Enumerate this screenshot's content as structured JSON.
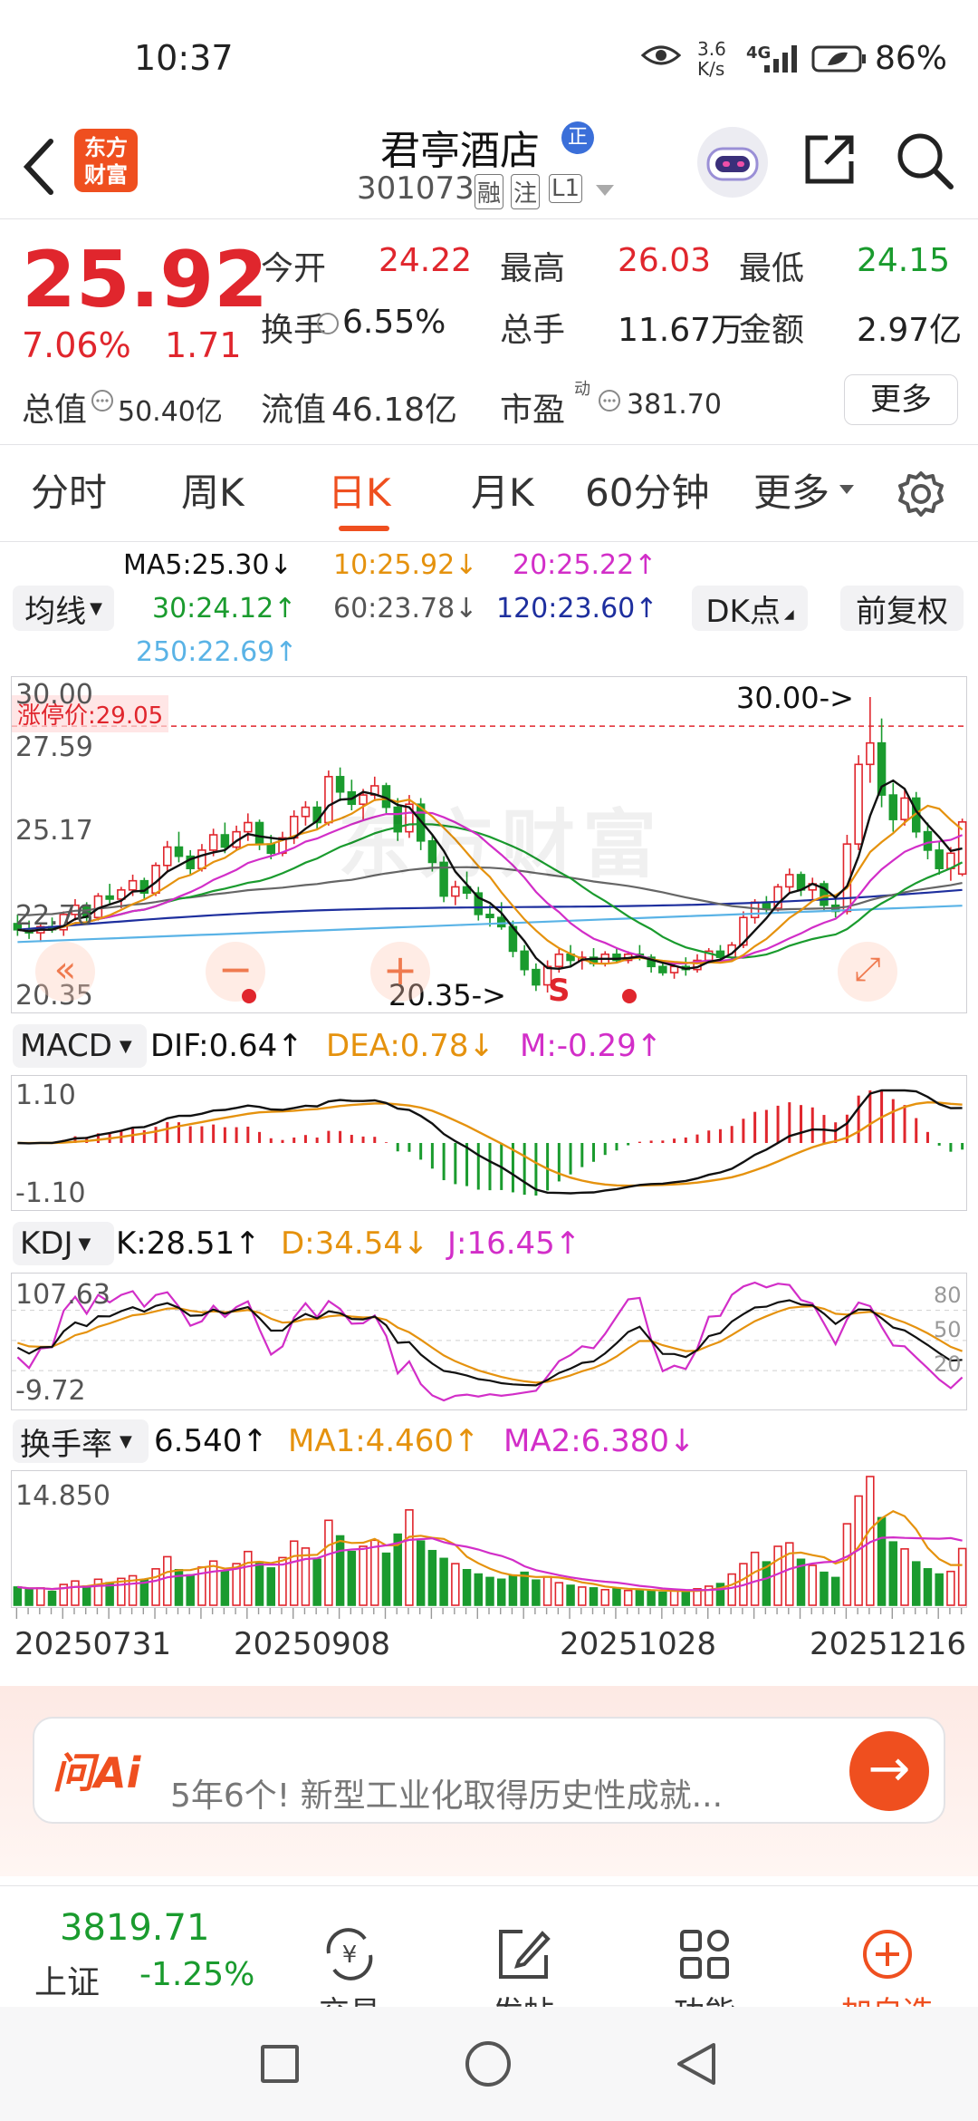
{
  "status": {
    "time": "10:37",
    "net_speed_value": "3.6",
    "net_speed_unit": "K/s",
    "network": "4G",
    "battery": "86%"
  },
  "header": {
    "title": "君亭酒店",
    "title_badge": "正",
    "code": "301073",
    "tags": [
      "融",
      "注",
      "L1"
    ],
    "logo_line1": "东方",
    "logo_line2": "财富",
    "back_icon": "back-arrow-icon",
    "share_icon": "share-icon",
    "search_icon": "search-icon"
  },
  "quote": {
    "price": "25.92",
    "change_pct": "7.06%",
    "change": "1.71",
    "fields": [
      {
        "label": "今开",
        "value": "24.22",
        "color": "#e0262d"
      },
      {
        "label": "最高",
        "value": "26.03",
        "color": "#e0262d"
      },
      {
        "label": "最低",
        "value": "24.15",
        "color": "#1a9b2e"
      },
      {
        "label": "换手",
        "value": "6.55%",
        "color": "#222222"
      },
      {
        "label": "总手",
        "value": "11.67万",
        "color": "#222222"
      },
      {
        "label": "金额",
        "value": "2.97亿",
        "color": "#222222"
      }
    ],
    "mcap_label": "总值",
    "mcap_value": "50.40亿",
    "float_label": "流值",
    "float_value": "46.18亿",
    "pe_label": "市盈",
    "pe_sup": "动",
    "pe_value": "381.70",
    "more_button": "更多"
  },
  "tabs": {
    "items": [
      "分时",
      "周K",
      "日K",
      "月K",
      "60分钟",
      "更多"
    ],
    "active": "日K",
    "settings_icon": "gear-icon"
  },
  "ma": {
    "selector": "均线",
    "ma5": "MA5:25.30↓",
    "ma10": "10:25.92↓",
    "ma20": "20:25.22↑",
    "ma30": "30:24.12↑",
    "ma60": "60:23.78↓",
    "ma120": "120:23.60↑",
    "ma250": "250:22.69↑",
    "dk_button": "DK点",
    "fuquan_button": "前复权",
    "colors": {
      "ma5": "#111111",
      "ma10": "#e5920e",
      "ma20": "#d22ec8",
      "ma30": "#1a9b2e",
      "ma60": "#666666",
      "ma120": "#1e2f9e",
      "ma250": "#5ab3e6"
    }
  },
  "kline": {
    "limit_up_label": "涨停价:29.05",
    "high_marker": "30.00->",
    "low_marker": "20.35->",
    "s_marker": "S",
    "watermark": "东方财富",
    "y_ticks": [
      "30.00",
      "27.59",
      "25.17",
      "22.76",
      "20.35"
    ],
    "prev_icon": "double-chevron-left-icon",
    "zoom_out_icon": "minus-icon",
    "zoom_in_icon": "plus-icon",
    "expand_icon": "expand-icon"
  },
  "macd": {
    "selector": "MACD",
    "dif": "DIF:0.64↑",
    "dea": "DEA:0.78↓",
    "m": "M:-0.29↑",
    "y_ticks": [
      "1.10",
      "-1.10"
    ]
  },
  "kdj": {
    "selector": "KDJ",
    "k": "K:28.51↑",
    "d": "D:34.54↓",
    "j": "J:16.45↑",
    "y_ticks": [
      "107.63",
      "-9.72"
    ],
    "levels": [
      "80",
      "50",
      "20"
    ]
  },
  "turnover": {
    "selector": "换手率",
    "value": "6.540↑",
    "ma1": "MA1:4.460↑",
    "ma2": "MA2:6.380↓",
    "y_tick": "14.850"
  },
  "dates": [
    "20250731",
    "20250908",
    "20251028",
    "20251216"
  ],
  "ai_banner": {
    "brand": "问Ai",
    "text": "5年6个!  新型工业化取得历史性成就...",
    "go_icon": "arrow-right-icon"
  },
  "bottom_nav": {
    "index_value": "3819.71",
    "index_name": "上证",
    "index_change": "-1.25%",
    "items": [
      {
        "label": "交易",
        "icon": "yuan-exchange-icon"
      },
      {
        "label": "发帖",
        "icon": "edit-icon"
      },
      {
        "label": "功能",
        "icon": "grid-icon"
      },
      {
        "label": "加自选",
        "icon": "plus-circle-icon"
      }
    ]
  },
  "chart_data": {
    "type": "candlestick",
    "y_range": [
      20.35,
      30.0
    ],
    "ohlc": [
      [
        22.6,
        22.9,
        22.2,
        22.4
      ],
      [
        22.4,
        22.7,
        22.1,
        22.3
      ],
      [
        22.3,
        22.6,
        22.0,
        22.5
      ],
      [
        22.5,
        22.8,
        22.3,
        22.4
      ],
      [
        22.4,
        23.0,
        22.2,
        22.9
      ],
      [
        22.9,
        23.4,
        22.7,
        23.2
      ],
      [
        23.2,
        23.3,
        22.6,
        22.8
      ],
      [
        22.8,
        23.6,
        22.7,
        23.5
      ],
      [
        23.5,
        23.9,
        23.2,
        23.4
      ],
      [
        23.4,
        23.8,
        23.1,
        23.7
      ],
      [
        23.7,
        24.2,
        23.5,
        24.0
      ],
      [
        24.0,
        24.1,
        23.4,
        23.6
      ],
      [
        23.6,
        24.6,
        23.5,
        24.5
      ],
      [
        24.5,
        25.3,
        24.3,
        25.1
      ],
      [
        25.1,
        25.6,
        24.6,
        24.8
      ],
      [
        24.8,
        25.0,
        24.2,
        24.4
      ],
      [
        24.4,
        25.2,
        24.3,
        25.0
      ],
      [
        25.0,
        25.7,
        24.8,
        25.5
      ],
      [
        25.5,
        25.9,
        24.9,
        25.1
      ],
      [
        25.1,
        25.8,
        25.0,
        25.6
      ],
      [
        25.6,
        26.2,
        25.3,
        25.9
      ],
      [
        25.9,
        26.0,
        25.0,
        25.2
      ],
      [
        25.2,
        25.5,
        24.7,
        24.9
      ],
      [
        24.9,
        25.6,
        24.8,
        25.4
      ],
      [
        25.4,
        26.3,
        25.2,
        26.1
      ],
      [
        26.1,
        26.6,
        25.8,
        26.4
      ],
      [
        26.4,
        26.6,
        25.7,
        25.9
      ],
      [
        25.9,
        27.6,
        25.8,
        27.4
      ],
      [
        27.4,
        27.7,
        26.6,
        26.9
      ],
      [
        26.9,
        27.3,
        26.3,
        26.5
      ],
      [
        26.5,
        27.0,
        26.0,
        26.8
      ],
      [
        26.8,
        27.4,
        26.6,
        27.1
      ],
      [
        27.1,
        27.2,
        26.2,
        26.4
      ],
      [
        26.4,
        26.7,
        25.3,
        25.6
      ],
      [
        25.6,
        26.8,
        25.4,
        26.5
      ],
      [
        26.5,
        26.7,
        25.0,
        25.3
      ],
      [
        25.3,
        25.5,
        24.3,
        24.6
      ],
      [
        24.6,
        24.8,
        23.3,
        23.5
      ],
      [
        23.5,
        24.0,
        23.2,
        23.8
      ],
      [
        23.8,
        24.3,
        23.4,
        23.6
      ],
      [
        23.6,
        23.8,
        22.7,
        22.9
      ],
      [
        22.9,
        23.2,
        22.5,
        22.8
      ],
      [
        22.8,
        23.3,
        22.4,
        22.5
      ],
      [
        22.5,
        22.7,
        21.5,
        21.7
      ],
      [
        21.7,
        21.9,
        20.9,
        21.1
      ],
      [
        21.1,
        21.3,
        20.4,
        20.6
      ],
      [
        20.6,
        21.4,
        20.35,
        21.2
      ],
      [
        21.2,
        21.8,
        21.0,
        21.6
      ],
      [
        21.6,
        21.9,
        21.2,
        21.4
      ],
      [
        21.4,
        21.7,
        21.1,
        21.5
      ],
      [
        21.5,
        21.8,
        21.2,
        21.3
      ],
      [
        21.3,
        21.7,
        21.2,
        21.6
      ],
      [
        21.6,
        21.8,
        21.3,
        21.4
      ],
      [
        21.4,
        21.7,
        21.3,
        21.6
      ],
      [
        21.6,
        21.9,
        21.4,
        21.5
      ],
      [
        21.5,
        21.6,
        21.0,
        21.2
      ],
      [
        21.2,
        21.4,
        20.9,
        21.0
      ],
      [
        21.0,
        21.3,
        20.8,
        21.2
      ],
      [
        21.2,
        21.5,
        20.9,
        21.1
      ],
      [
        21.1,
        21.6,
        21.0,
        21.4
      ],
      [
        21.4,
        21.8,
        21.3,
        21.7
      ],
      [
        21.7,
        21.9,
        21.4,
        21.5
      ],
      [
        21.5,
        22.0,
        21.4,
        21.9
      ],
      [
        21.9,
        23.0,
        21.8,
        22.8
      ],
      [
        22.8,
        23.4,
        22.6,
        23.3
      ],
      [
        23.3,
        23.5,
        22.9,
        23.1
      ],
      [
        23.1,
        23.9,
        23.0,
        23.8
      ],
      [
        23.8,
        24.4,
        23.6,
        24.2
      ],
      [
        24.2,
        24.3,
        23.5,
        23.7
      ],
      [
        23.7,
        24.1,
        23.4,
        23.9
      ],
      [
        23.9,
        24.0,
        23.0,
        23.2
      ],
      [
        23.2,
        23.4,
        22.8,
        23.0
      ],
      [
        23.0,
        25.5,
        22.9,
        25.2
      ],
      [
        25.2,
        28.1,
        25.0,
        27.8
      ],
      [
        27.8,
        30.0,
        27.2,
        28.5
      ],
      [
        28.5,
        29.3,
        26.4,
        26.8
      ],
      [
        26.8,
        27.2,
        25.6,
        26.0
      ],
      [
        26.0,
        27.0,
        25.8,
        26.7
      ],
      [
        26.7,
        26.9,
        25.4,
        25.6
      ],
      [
        25.6,
        25.9,
        24.7,
        25.0
      ],
      [
        25.0,
        25.3,
        24.2,
        24.4
      ],
      [
        24.4,
        25.1,
        24.0,
        24.9
      ],
      [
        24.22,
        26.03,
        24.15,
        25.92
      ]
    ],
    "turnover_range": [
      0,
      14.85
    ],
    "turnover": [
      2.1,
      1.8,
      2.0,
      1.6,
      2.4,
      2.8,
      2.2,
      3.0,
      2.6,
      3.1,
      3.4,
      2.9,
      4.2,
      5.6,
      4.1,
      3.5,
      4.4,
      5.1,
      4.0,
      4.8,
      6.2,
      5.0,
      4.3,
      5.5,
      7.4,
      6.6,
      5.3,
      9.8,
      8.0,
      6.2,
      6.8,
      7.5,
      6.0,
      8.2,
      11.0,
      7.4,
      6.3,
      5.4,
      4.8,
      4.1,
      3.6,
      3.2,
      3.0,
      3.4,
      3.8,
      2.9,
      3.3,
      2.6,
      2.3,
      2.1,
      2.0,
      1.8,
      1.9,
      1.7,
      1.8,
      1.6,
      1.5,
      1.7,
      1.6,
      1.9,
      2.2,
      2.5,
      3.6,
      4.8,
      6.1,
      5.0,
      6.8,
      7.2,
      5.3,
      4.6,
      3.8,
      3.2,
      9.4,
      12.6,
      14.85,
      10.1,
      7.3,
      6.5,
      5.0,
      4.2,
      3.6,
      3.9,
      6.54
    ],
    "macd_range": [
      -1.1,
      1.1
    ],
    "kdj_range": [
      -9.72,
      107.63
    ],
    "x_ticks": [
      "20250731",
      "20250908",
      "20251028",
      "20251216"
    ]
  }
}
